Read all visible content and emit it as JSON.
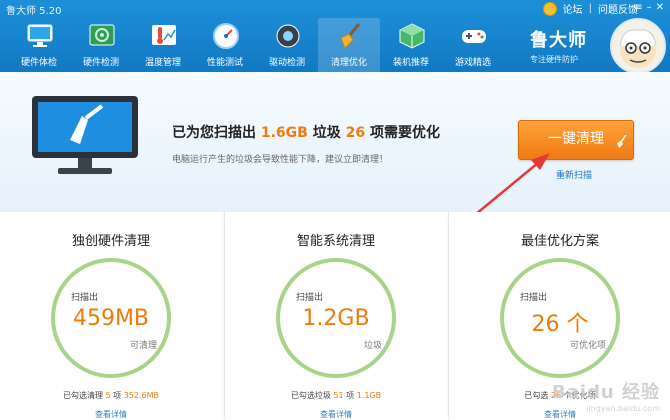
{
  "app": {
    "title": "鲁大师 5.20"
  },
  "top_links": {
    "forum": "论坛",
    "feedback": "问题反馈",
    "separator": "|"
  },
  "nav": [
    {
      "label": "硬件体检",
      "icon": "monitor-icon"
    },
    {
      "label": "硬件检测",
      "icon": "circuit-board-icon"
    },
    {
      "label": "温度管理",
      "icon": "thermometer-icon"
    },
    {
      "label": "性能测试",
      "icon": "speedometer-icon"
    },
    {
      "label": "驱动检测",
      "icon": "gear-chip-icon"
    },
    {
      "label": "清理优化",
      "icon": "broom-icon",
      "active": true
    },
    {
      "label": "装机推荐",
      "icon": "cube-icon"
    },
    {
      "label": "游戏精选",
      "icon": "gamepad-icon"
    }
  ],
  "brand": {
    "name": "鲁大师",
    "tagline": "专注硬件防护"
  },
  "main": {
    "headline_prefix": "已为您扫描出 ",
    "headline_size": "1.6GB",
    "headline_mid": " 垃圾 ",
    "headline_count": "26",
    "headline_suffix": " 项需要优化",
    "subline": "电脑运行产生的垃圾会导致性能下降，建议立即清理！",
    "clean_button": "一键清理",
    "rescan_link": "重新扫描"
  },
  "cards": [
    {
      "title": "独创硬件清理",
      "scanned_label": "扫描出",
      "value": "459MB",
      "unit": "可清理",
      "summary_prefix": "已勾选清理 ",
      "summary_count": "5",
      "summary_mid": " 项 ",
      "summary_size": "352.6MB",
      "link": "查看详情"
    },
    {
      "title": "智能系统清理",
      "scanned_label": "扫描出",
      "value": "1.2GB",
      "unit": "垃圾",
      "summary_prefix": "已勾选垃圾 ",
      "summary_count": "51",
      "summary_mid": " 项 ",
      "summary_size": "1.1GB",
      "link": "查看详情"
    },
    {
      "title": "最佳优化方案",
      "scanned_label": "扫描出",
      "value": "26 个",
      "unit": "可优化项",
      "summary_prefix": "已勾选 ",
      "summary_count": "26",
      "summary_mid": " 个优化项",
      "summary_size": "",
      "link": "查看详情"
    }
  ],
  "watermark": {
    "text": "Baidu 经验",
    "sub": "jingyan.baidu.com"
  },
  "colors": {
    "header": "#1a84cf",
    "accent": "#f07a0a",
    "ring": "#a8d48a",
    "link": "#1a74c9"
  }
}
